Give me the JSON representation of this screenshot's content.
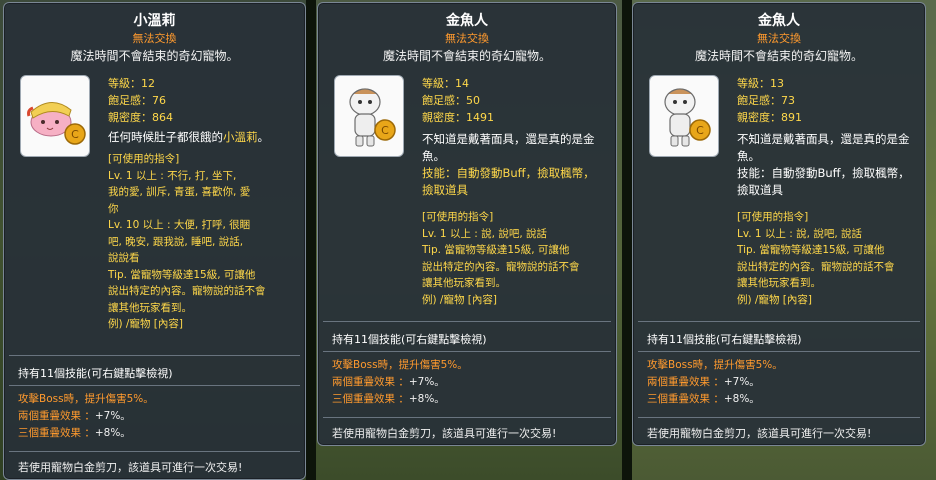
{
  "cards": [
    {
      "name": "小溫莉",
      "trade": "無法交換",
      "subtitle": "魔法時間不會結束的奇幻寵物。",
      "stats": [
        "等級：12",
        "飽足感：76",
        "親密度：864"
      ],
      "desc_lines": [
        "任何時候肚子都很餓的小溫莉。"
      ],
      "cmd_header": "[可使用的指令]",
      "cmd_lines": [
        "Lv. 1 以上 : 不行, 打, 坐下,",
        "我的愛, 訓斥, 青蛋, 喜歡你, 愛",
        "你",
        "Lv. 10 以上 : 大便, 打呼, 很睏",
        "吧, 晚安, 跟我說, 睡吧, 說話,",
        "說說看",
        "Tip. 當寵物等級達15級, 可讓他",
        "說出特定的內容。寵物說的話不會",
        "讓其他玩家看到。",
        "例) /寵物 [內容]"
      ],
      "skill_header": "持有11個技能(可右鍵點擊檢視)",
      "boss": "攻擊Boss時，提升傷害5%。",
      "two_label": "兩個重疊效果 ：",
      "two_val": "+7%。",
      "three_label": "三個重疊效果 ：",
      "three_val": "+8%。",
      "footer": "若使用寵物白金剪刀，該道具可進行一次交易!"
    },
    {
      "name": "金魚人",
      "trade": "無法交換",
      "subtitle": "魔法時間不會結束的奇幻寵物。",
      "stats": [
        "等級：14",
        "飽足感：50",
        "親密度：1491"
      ],
      "desc_lines": [
        "不知道是戴著面具，還是真的是金",
        "魚。"
      ],
      "skill_line1": "技能：自動發動Buff，撿取楓幣，",
      "skill_line2": "撿取道具",
      "cmd_header": "[可使用的指令]",
      "cmd_lines": [
        "Lv. 1 以上 : 說, 說吧, 說話",
        "Tip. 當寵物等級達15級, 可讓他",
        "說出特定的內容。寵物說的話不會",
        "讓其他玩家看到。",
        "例) /寵物 [內容]"
      ],
      "skill_header": "持有11個技能(可右鍵點擊檢視)",
      "boss": "攻擊Boss時，提升傷害5%。",
      "two_label": "兩個重疊效果 ：",
      "two_val": "+7%。",
      "three_label": "三個重疊效果 ：",
      "three_val": "+8%。",
      "footer": "若使用寵物白金剪刀，該道具可進行一次交易!"
    },
    {
      "name": "金魚人",
      "trade": "無法交換",
      "subtitle": "魔法時間不會結束的奇幻寵物。",
      "stats": [
        "等級：13",
        "飽足感：73",
        "親密度：891"
      ],
      "desc_lines": [
        "不知道是戴著面具，還是真的是金",
        "魚。"
      ],
      "skill_line1": "技能：自動發動Buff，撿取楓幣，",
      "skill_line2": "撿取道具",
      "cmd_header": "[可使用的指令]",
      "cmd_lines": [
        "Lv. 1 以上 : 說, 說吧, 說話",
        "Tip. 當寵物等級達15級, 可讓他",
        "說出特定的內容。寵物說的話不會",
        "讓其他玩家看到。",
        "例) /寵物 [內容]"
      ],
      "skill_header": "持有11個技能(可右鍵點擊檢視)",
      "boss": "攻擊Boss時，提升傷害5%。",
      "two_label": "兩個重疊效果 ：",
      "two_val": "+7%。",
      "three_label": "三個重疊效果 ：",
      "three_val": "+8%。",
      "footer": "若使用寵物白金剪刀，該道具可進行一次交易!"
    }
  ]
}
